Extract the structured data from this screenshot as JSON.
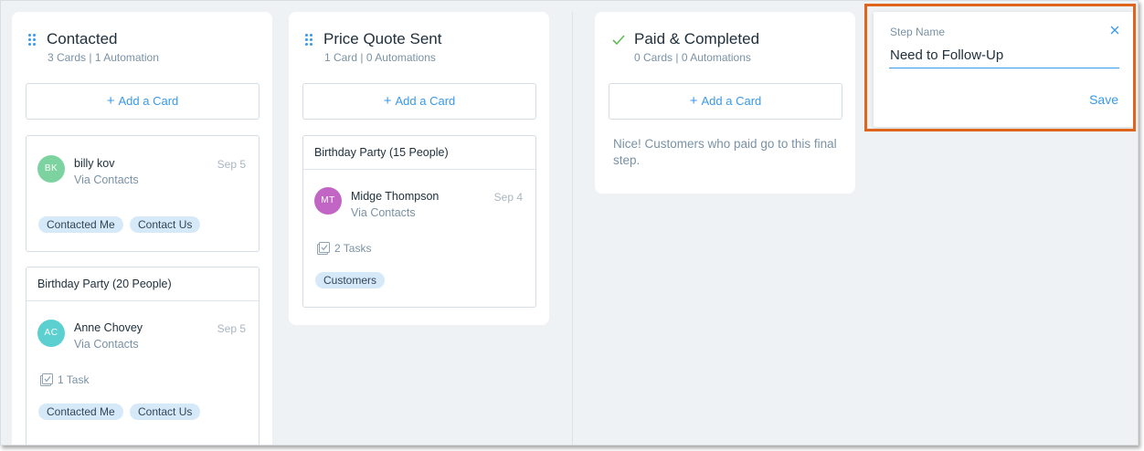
{
  "columns": [
    {
      "title": "Contacted",
      "cards_count": "3 Cards",
      "automations": "1 Automation",
      "add_card_label": "Add a Card",
      "cards": [
        {
          "contact": {
            "initials": "BK",
            "name": "billy kov",
            "via": "Via Contacts",
            "date": "Sep 5",
            "avatar_color": "#7dd3a0"
          },
          "tags": [
            "Contacted Me",
            "Contact Us"
          ]
        },
        {
          "title": "Birthday Party (20 People)",
          "contact": {
            "initials": "AC",
            "name": "Anne Chovey",
            "via": "Via Contacts",
            "date": "Sep 5",
            "avatar_color": "#5cd0d0"
          },
          "tasks": "1 Task",
          "tags": [
            "Contacted Me",
            "Contact Us"
          ]
        }
      ]
    },
    {
      "title": "Price Quote Sent",
      "cards_count": "1 Card",
      "automations": "0 Automations",
      "add_card_label": "Add a Card",
      "cards": [
        {
          "title": "Birthday Party (15 People)",
          "contact": {
            "initials": "MT",
            "name": "Midge Thompson",
            "via": "Via Contacts",
            "date": "Sep 4",
            "avatar_color": "#c266c6"
          },
          "tasks": "2 Tasks",
          "tags": [
            "Customers"
          ]
        }
      ]
    },
    {
      "title": "Paid & Completed",
      "cards_count": "0 Cards",
      "automations": "0 Automations",
      "add_card_label": "Add a Card",
      "note": "Nice! Customers who paid go to this final step."
    }
  ],
  "new_step": {
    "label": "Step Name",
    "value": "Need to Follow-Up",
    "save_label": "Save"
  },
  "separator": "|",
  "colors": {
    "accent": "#3899ec",
    "highlight": "#e0651c",
    "tag_bg": "#d6e9f9"
  }
}
